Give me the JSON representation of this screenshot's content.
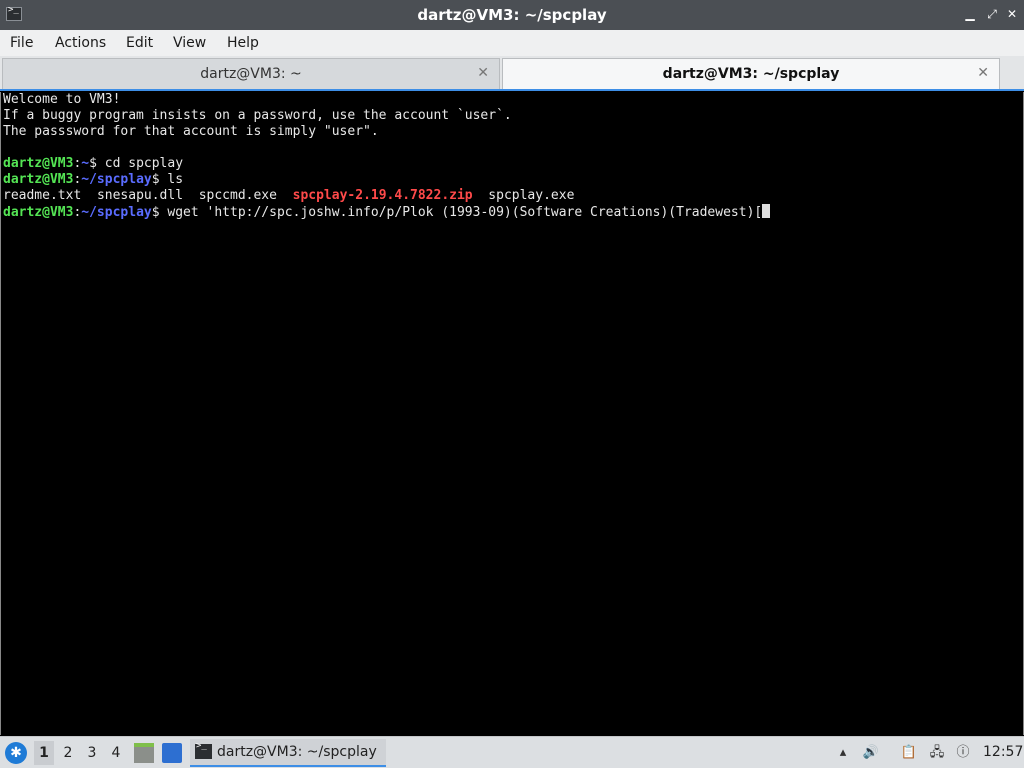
{
  "window": {
    "title": "dartz@VM3: ~/spcplay",
    "icon": "terminal-icon"
  },
  "menu": [
    "File",
    "Actions",
    "Edit",
    "View",
    "Help"
  ],
  "tabs": [
    {
      "label": "dartz@VM3: ~",
      "active": false
    },
    {
      "label": "dartz@VM3: ~/spcplay",
      "active": true
    }
  ],
  "terminal": {
    "motd": [
      "Welcome to VM3!",
      "If a buggy program insists on a password, use the account `user`.",
      "The passsword for that account is simply \"user\"."
    ],
    "cmd1": {
      "user": "dartz@VM3",
      "path": "~",
      "command": "cd spcplay"
    },
    "cmd2": {
      "user": "dartz@VM3",
      "path": "~/spcplay",
      "command": "ls"
    },
    "ls_output": {
      "f1": "readme.txt",
      "f2": "snesapu.dll",
      "f3": "spccmd.exe",
      "zip": "spcplay-2.19.4.7822.zip",
      "f5": "spcplay.exe"
    },
    "cmd3": {
      "user": "dartz@VM3",
      "path": "~/spcplay",
      "command": "wget 'http://spc.joshw.info/p/Plok (1993-09)(Software Creations)(Tradewest)["
    }
  },
  "taskbar": {
    "workspaces": [
      "1",
      "2",
      "3",
      "4"
    ],
    "active_workspace": "1",
    "task_label": "dartz@VM3: ~/spcplay",
    "clock": "12:57"
  },
  "colors": {
    "accent": "#3d8ee6",
    "prompt_user": "#54e554",
    "prompt_path": "#5a6cff",
    "archive": "#ff4a4a"
  }
}
